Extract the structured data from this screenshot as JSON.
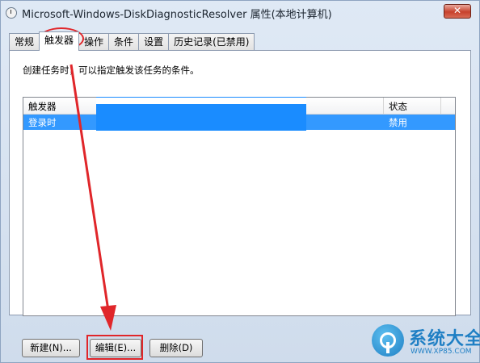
{
  "window": {
    "title": "Microsoft-Windows-DiskDiagnosticResolver 属性(本地计算机)",
    "close_label": "✕"
  },
  "tabs": [
    {
      "label": "常规"
    },
    {
      "label": "触发器",
      "active": true
    },
    {
      "label": "操作"
    },
    {
      "label": "条件"
    },
    {
      "label": "设置"
    },
    {
      "label": "历史记录(已禁用)"
    }
  ],
  "panel": {
    "description": "创建任务时，可以指定触发该任务的条件。"
  },
  "table": {
    "columns": [
      "触发器",
      "状态"
    ],
    "rows": [
      {
        "trigger": "登录时",
        "status": "禁用"
      }
    ]
  },
  "buttons": {
    "new": "新建(N)...",
    "edit": "编辑(E)...",
    "delete": "删除(D)"
  },
  "watermark": {
    "title": "系统大全",
    "url": "WWW.XP85.COM"
  },
  "colors": {
    "annotation": "#e0262a",
    "selection": "#3399ff"
  }
}
